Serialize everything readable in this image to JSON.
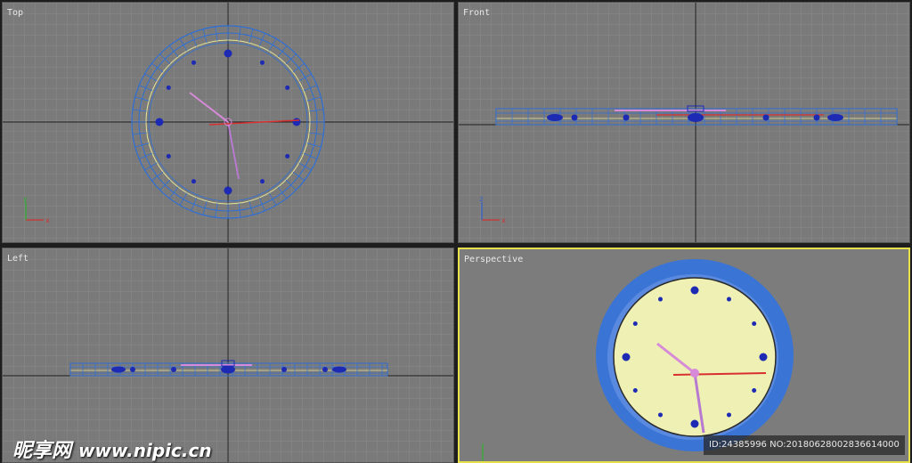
{
  "viewports": {
    "top": {
      "label": "Top"
    },
    "front": {
      "label": "Front"
    },
    "left": {
      "label": "Left"
    },
    "perspective": {
      "label": "Perspective"
    }
  },
  "axes": {
    "x": "x",
    "y": "y",
    "z": "z"
  },
  "watermark": {
    "brand": "昵享网",
    "url": "www.nipic.cn"
  },
  "image_id": "ID:24385996 NO:20180628002836614000",
  "colors": {
    "viewport_bg": "#7a7a7a",
    "grid_line": "#8c8c8c",
    "world_axis": "#202020",
    "wireframe_rim": "#2f6fd6",
    "clock_face": "#eef0b4",
    "clock_rim": "#3a74d4",
    "hour_marker": "#1d2ab4",
    "hand_pink": "#d68ad8",
    "second_hand": "#d83030",
    "active_border": "#e8e04a"
  }
}
